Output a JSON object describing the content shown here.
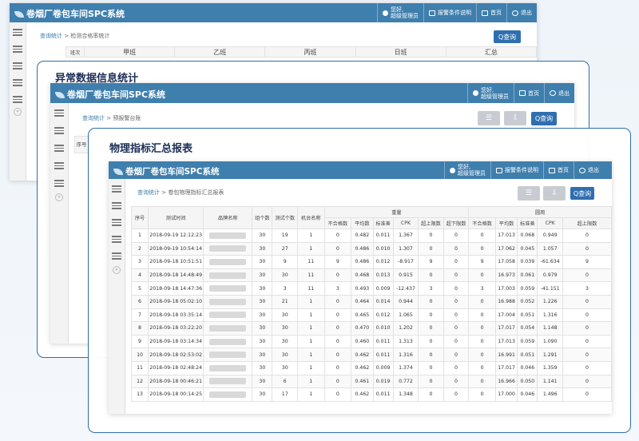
{
  "app_title": "卷烟厂卷包车间SPC系统",
  "header": {
    "user_line1": "您好,",
    "user_line2": "超级管理员",
    "alert_label": "报警条件说明",
    "home_label": "首页",
    "logout_label": "退出"
  },
  "back_window": {
    "crumb_root": "查询统计",
    "crumb_sep": ">",
    "crumb_page": "检测合格率统计",
    "query_label": "Q查询",
    "columns": [
      "班次",
      "甲班",
      "乙班",
      "丙班",
      "日班",
      "汇总"
    ]
  },
  "mid_frame": {
    "title": "异常数据信息统计",
    "crumb_root": "查询统计",
    "crumb_sep": ">",
    "crumb_page": "预报警台账",
    "query_label": "Q查询",
    "first_col": "序号"
  },
  "front_frame": {
    "title": "物理指标汇总报表",
    "crumb_root": "查询统计",
    "crumb_sep": ">",
    "crumb_page": "卷包物理指标汇总报表",
    "query_label": "Q查询"
  },
  "table": {
    "head_fixed": [
      "序号",
      "测试时间",
      "品牌名称",
      "组个数",
      "测试个数",
      "机台名称"
    ],
    "group1": "重量",
    "group2": "圆周",
    "sub1": [
      "不合格数",
      "平均数",
      "标准差",
      "CPK",
      "超上限数",
      "超下限数"
    ],
    "sub2": [
      "不合格数",
      "平均数",
      "标准差",
      "CPK",
      "超上限数",
      "超下限数"
    ],
    "rows": [
      [
        "1",
        "2018-09-19 12:12:23",
        "30",
        "19",
        "1",
        "0",
        "0.482",
        "0.011",
        "1.367",
        "0",
        "0",
        "0",
        "17.013",
        "0.068",
        "0.949",
        "0"
      ],
      [
        "2",
        "2018-09-19 10:54:14",
        "30",
        "27",
        "1",
        "0",
        "0.486",
        "0.010",
        "1.307",
        "0",
        "0",
        "0",
        "17.062",
        "0.045",
        "1.057",
        "0"
      ],
      [
        "3",
        "2018-09-18 10:51:51",
        "30",
        "9",
        "11",
        "9",
        "0.486",
        "0.012",
        "-8.917",
        "9",
        "0",
        "9",
        "17.058",
        "0.039",
        "-61.634",
        "9"
      ],
      [
        "4",
        "2018-09-18 14:48:49",
        "30",
        "30",
        "11",
        "0",
        "0.468",
        "0.013",
        "0.915",
        "0",
        "0",
        "0",
        "16.973",
        "0.061",
        "0.979",
        "0"
      ],
      [
        "5",
        "2018-09-18 14:47:36",
        "30",
        "3",
        "11",
        "3",
        "0.493",
        "0.009",
        "-12.437",
        "3",
        "0",
        "3",
        "17.003",
        "0.059",
        "-41.151",
        "3"
      ],
      [
        "6",
        "2018-09-18 05:02:10",
        "30",
        "21",
        "1",
        "0",
        "0.464",
        "0.014",
        "0.944",
        "0",
        "0",
        "0",
        "16.988",
        "0.052",
        "1.226",
        "0"
      ],
      [
        "7",
        "2018-09-18 03:35:14",
        "30",
        "30",
        "1",
        "0",
        "0.465",
        "0.012",
        "1.065",
        "0",
        "0",
        "0",
        "17.004",
        "0.051",
        "1.316",
        "0"
      ],
      [
        "8",
        "2018-09-18 03:22:20",
        "30",
        "30",
        "1",
        "0",
        "0.470",
        "0.010",
        "1.202",
        "0",
        "0",
        "0",
        "17.017",
        "0.054",
        "1.148",
        "0"
      ],
      [
        "9",
        "2018-09-18 03:14:34",
        "30",
        "30",
        "1",
        "0",
        "0.460",
        "0.011",
        "1.313",
        "0",
        "0",
        "0",
        "17.013",
        "0.059",
        "1.090",
        "0"
      ],
      [
        "10",
        "2018-09-18 02:53:02",
        "30",
        "30",
        "1",
        "0",
        "0.462",
        "0.011",
        "1.316",
        "0",
        "0",
        "0",
        "16.991",
        "0.051",
        "1.291",
        "0"
      ],
      [
        "11",
        "2018-09-18 02:48:24",
        "30",
        "30",
        "1",
        "0",
        "0.462",
        "0.009",
        "1.374",
        "0",
        "0",
        "0",
        "17.017",
        "0.046",
        "1.359",
        "0"
      ],
      [
        "12",
        "2018-09-18 00:46:21",
        "30",
        "6",
        "1",
        "0",
        "0.461",
        "0.019",
        "0.772",
        "0",
        "0",
        "0",
        "16.966",
        "0.050",
        "1.141",
        "0"
      ],
      [
        "13",
        "2018-09-18 00:14:25",
        "30",
        "17",
        "1",
        "0",
        "0.462",
        "0.011",
        "1.348",
        "0",
        "0",
        "0",
        "17.000",
        "0.046",
        "1.496",
        "0"
      ]
    ]
  }
}
